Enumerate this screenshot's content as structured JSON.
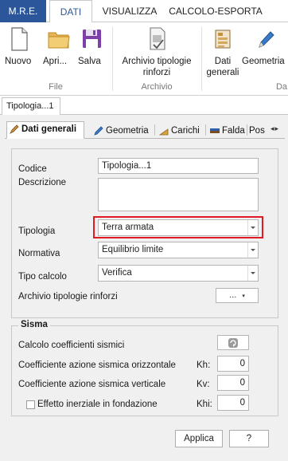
{
  "ribbon": {
    "tabs": [
      "M.R.E.",
      "DATI",
      "VISUALIZZA",
      "CALCOLO-ESPORTA"
    ],
    "buttons": {
      "nuovo": "Nuovo",
      "apri": "Apri...",
      "salva": "Salva",
      "archivio": "Archivio tipologie rinforzi",
      "dati_generali": "Dati generali",
      "geometria": "Geometria"
    },
    "groups": {
      "file": "File",
      "archivio": "Archivio",
      "dati": "Da"
    }
  },
  "doc_tab": "Tipologia...1",
  "sub_tabs": [
    "Dati generali",
    "Geometria",
    "Carichi",
    "Falda",
    "Pos"
  ],
  "sub_tab_arrows": "◂▸",
  "form": {
    "codice_label": "Codice",
    "codice_value": "Tipologia...1",
    "descrizione_label": "Descrizione",
    "descrizione_value": "",
    "tipologia_label": "Tipologia",
    "tipologia_value": "Terra armata",
    "normativa_label": "Normativa",
    "normativa_value": "Equilibrio limite",
    "tipo_calcolo_label": "Tipo calcolo",
    "tipo_calcolo_value": "Verifica",
    "archivio_label": "Archivio tipologie rinforzi",
    "archivio_button": "..."
  },
  "sisma": {
    "legend": "Sisma",
    "calcolo_label": "Calcolo coefficienti sismici",
    "orizzontale_label": "Coefficiente azione sismica orizzontale",
    "kh_label": "Kh:",
    "kh_value": "0",
    "verticale_label": "Coefficiente azione sismica verticale",
    "kv_label": "Kv:",
    "kv_value": "0",
    "effetto_label": "Effetto inerziale in fondazione",
    "khi_label": "Khi:",
    "khi_value": "0"
  },
  "buttons": {
    "applica": "Applica",
    "help": "?"
  },
  "colors": {
    "file_tab": "#2b579a",
    "highlight": "#e01b24"
  }
}
